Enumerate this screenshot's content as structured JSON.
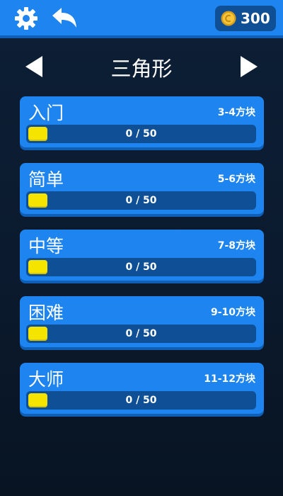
{
  "header": {
    "settings_icon": "gear-icon",
    "back_icon": "undo-arrow-icon",
    "coin_icon": "coin-icon",
    "coins": "300"
  },
  "level_selector": {
    "title": "三角形",
    "prev_icon": "triangle-left-icon",
    "next_icon": "triangle-right-icon"
  },
  "difficulties": [
    {
      "name": "入门",
      "range": "3-4方块",
      "progress_text": "0 / 50",
      "completed": 0,
      "total": 50
    },
    {
      "name": "简单",
      "range": "5-6方块",
      "progress_text": "0 / 50",
      "completed": 0,
      "total": 50
    },
    {
      "name": "中等",
      "range": "7-8方块",
      "progress_text": "0 / 50",
      "completed": 0,
      "total": 50
    },
    {
      "name": "困难",
      "range": "9-10方块",
      "progress_text": "0 / 50",
      "completed": 0,
      "total": 50
    },
    {
      "name": "大师",
      "range": "11-12方块",
      "progress_text": "0 / 50",
      "completed": 0,
      "total": 50
    }
  ],
  "colors": {
    "accent_blue": "#1d84f0",
    "progress_track": "#0e4f95",
    "progress_fill": "#f5e400",
    "background": "#0b1a2e"
  }
}
